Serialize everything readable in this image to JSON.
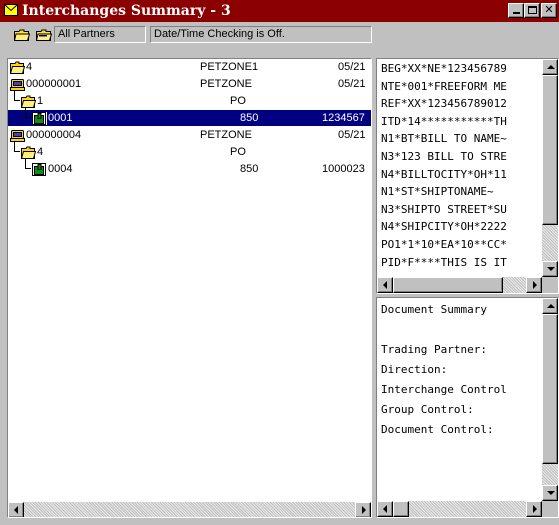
{
  "window": {
    "title": "Interchanges Summary - 3",
    "title_bar_color": "#8b0000",
    "controls": [
      "minimize-icon",
      "maximize-icon",
      "close-icon"
    ]
  },
  "toolbar": {
    "icons": [
      "open-folder-icon",
      "open-folder-icon"
    ],
    "partners_filter": "All Partners",
    "datetime_status": "Date/Time Checking is Off."
  },
  "tree": {
    "selection_color": "#000080",
    "rows": [
      {
        "level": 0,
        "icon": "open-folder-icon",
        "label": "4",
        "partner": "PETZONE1",
        "date": "05/21"
      },
      {
        "level": 0,
        "icon": "interchange-icon",
        "label": "000000001",
        "partner": "PETZONE",
        "date": "05/21"
      },
      {
        "level": 1,
        "icon": "open-folder-icon",
        "label": "1",
        "doc_type": "PO"
      },
      {
        "level": 2,
        "icon": "document-icon",
        "label": "0001",
        "doc_type": "850",
        "control": "1234567",
        "selected": true
      },
      {
        "level": 0,
        "icon": "interchange-icon",
        "label": "000000004",
        "partner": "PETZONE",
        "date": "05/21"
      },
      {
        "level": 1,
        "icon": "open-folder-icon",
        "label": "4",
        "doc_type": "PO"
      },
      {
        "level": 2,
        "icon": "document-icon",
        "label": "0004",
        "doc_type": "850",
        "control": "1000023"
      }
    ]
  },
  "edi_lines": [
    "BEG*XX*NE*123456789",
    "NTE*001*FREEFORM ME",
    "REF*XX*123456789012",
    "ITD*14***********TH",
    "N1*BT*BILL TO NAME~",
    "N3*123 BILL TO STRE",
    "N4*BILLTOCITY*OH*11",
    "N1*ST*SHIPTONAME~",
    "N3*SHIPTO STREET*SU",
    "N4*SHIPCITY*OH*2222",
    "PO1*1*10*EA*10**CC*",
    "PID*F****THIS IS IT"
  ],
  "summary_lines": [
    "Document Summary",
    "",
    "Trading Partner:",
    "Direction:",
    "Interchange Control",
    "Group Control:",
    "Document Control:"
  ]
}
